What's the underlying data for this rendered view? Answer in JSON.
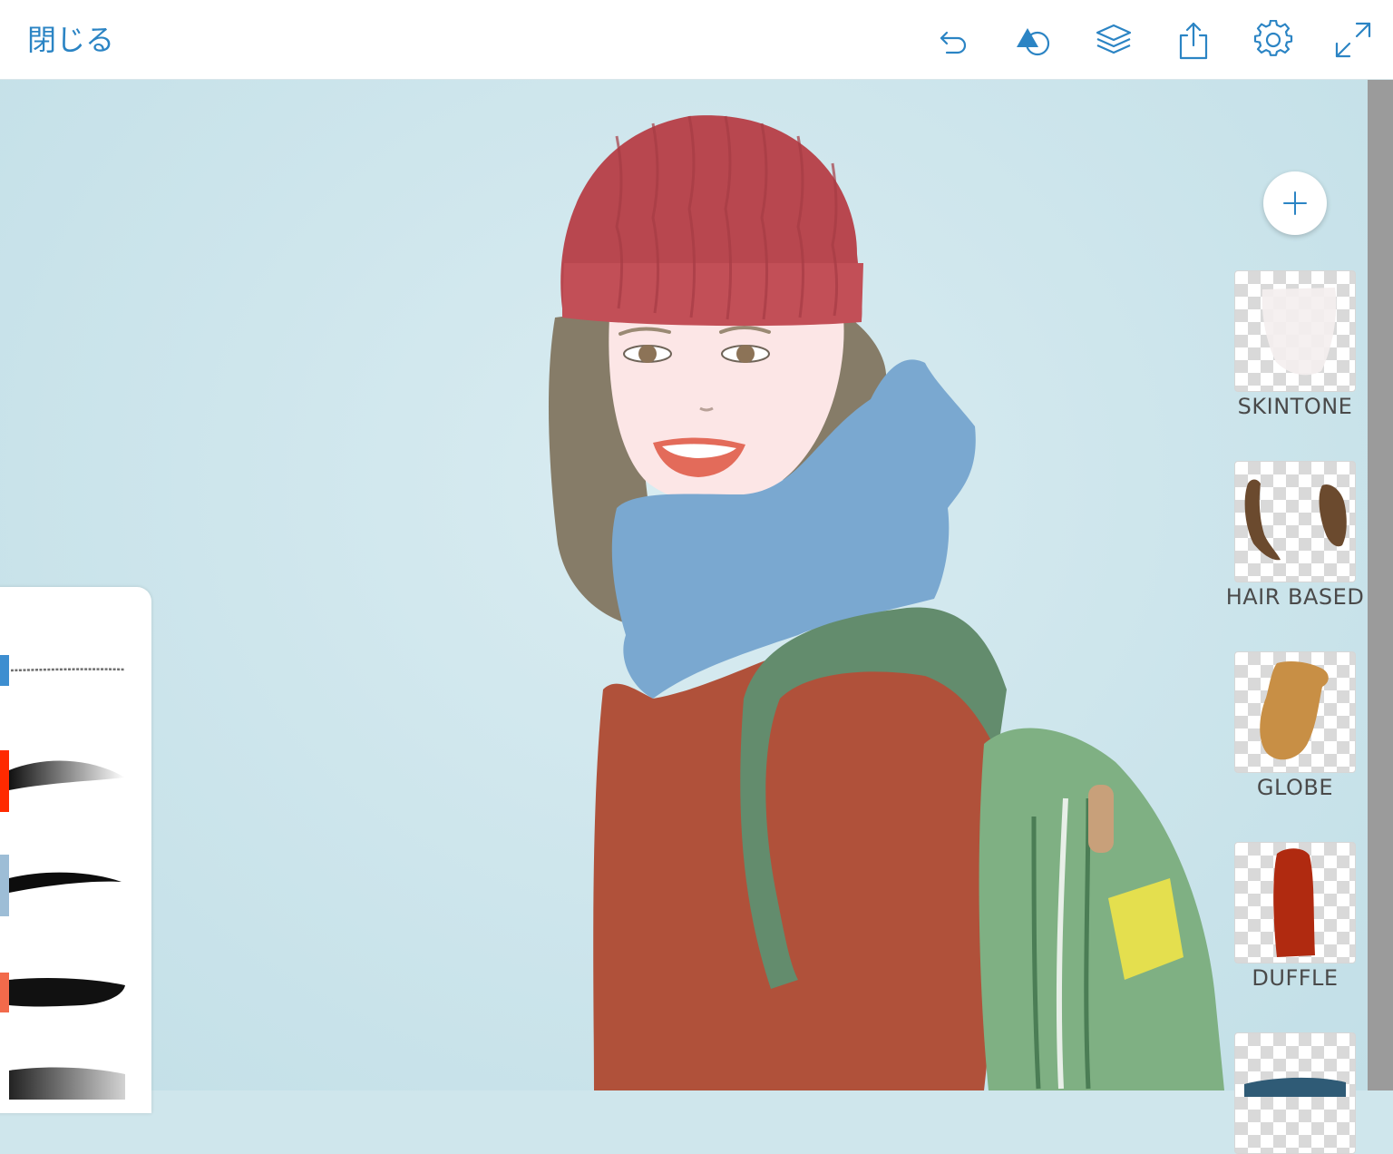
{
  "toolbar": {
    "close_label": "閉じる",
    "accent_color": "#2b84c4",
    "tools": [
      {
        "name": "undo-icon"
      },
      {
        "name": "shapes-icon"
      },
      {
        "name": "layers-icon"
      },
      {
        "name": "share-icon"
      },
      {
        "name": "settings-gear-icon"
      },
      {
        "name": "fullscreen-icon"
      }
    ]
  },
  "layers": {
    "add_icon": "plus-icon",
    "items": [
      {
        "label": "SKINTONE"
      },
      {
        "label": "HAIR BASED"
      },
      {
        "label": "GLOBE"
      },
      {
        "label": "DUFFLE"
      }
    ]
  },
  "brushes": {
    "items": [
      {
        "color": "#3d8ed0"
      },
      {
        "color": "#ff2a00"
      },
      {
        "color": "#9dbdd6"
      },
      {
        "color": "#f26a4b"
      }
    ]
  }
}
